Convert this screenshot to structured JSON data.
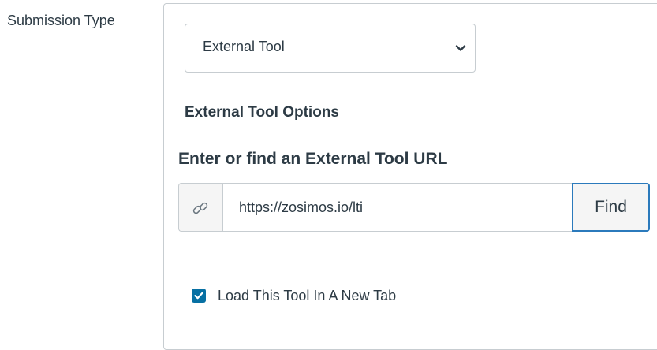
{
  "submission_type": {
    "label": "Submission Type",
    "selected": "External Tool"
  },
  "external_tool": {
    "section_title": "External Tool Options",
    "url_heading": "Enter or find an External Tool URL",
    "url_value": "https://zosimos.io/lti",
    "find_label": "Find",
    "new_tab_label": "Load This Tool In A New Tab",
    "new_tab_checked": true
  },
  "icons": {
    "select_arrow": "chevron-down-icon",
    "url_prefix": "link-icon",
    "checkbox_mark": "checkmark-icon"
  },
  "colors": {
    "text": "#2d3b45",
    "border": "#c7cdd1",
    "focus_border": "#2b7abc",
    "checkbox": "#0770a3"
  }
}
